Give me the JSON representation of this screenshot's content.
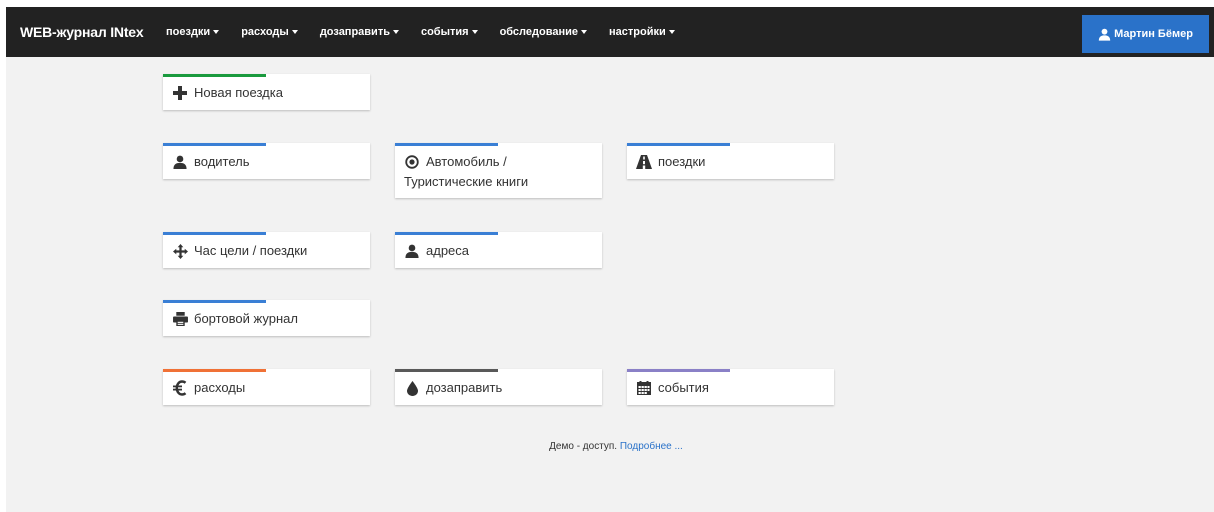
{
  "navbar": {
    "brand": "WEB-журнал INtex",
    "menu": [
      {
        "label": "поездки"
      },
      {
        "label": "расходы"
      },
      {
        "label": "дозаправить"
      },
      {
        "label": "события"
      },
      {
        "label": "обследование"
      },
      {
        "label": "настройки"
      }
    ],
    "user_label": "Мартин Бёмер"
  },
  "tiles": {
    "new_trip": {
      "label": "Новая поездка",
      "icon": "plus-icon",
      "color": "#1a9a3e"
    },
    "driver": {
      "label": "водитель",
      "icon": "user-icon",
      "color": "#3a7fd5"
    },
    "vehicle": {
      "label_line1": "Автомобиль /",
      "label_line2": "Туристические книги",
      "icon": "record-icon",
      "color": "#3a7fd5"
    },
    "trips": {
      "label": "поездки",
      "icon": "road-icon",
      "color": "#3a7fd5"
    },
    "purpose": {
      "label": "Час цели / поездки",
      "icon": "move-icon",
      "color": "#3a7fd5"
    },
    "addresses": {
      "label": "адреса",
      "icon": "user-icon",
      "color": "#3a7fd5"
    },
    "logbook": {
      "label": "бортовой журнал",
      "icon": "print-icon",
      "color": "#3a7fd5"
    },
    "expenses": {
      "label": "расходы",
      "icon": "euro-icon",
      "color": "#f07136"
    },
    "refuel": {
      "label": "дозаправить",
      "icon": "drop-icon",
      "color": "#595959"
    },
    "events": {
      "label": "события",
      "icon": "calendar-icon",
      "color": "#8a80c7"
    }
  },
  "footer": {
    "text": "Демо - доступ. ",
    "link": "Подробнее ..."
  }
}
